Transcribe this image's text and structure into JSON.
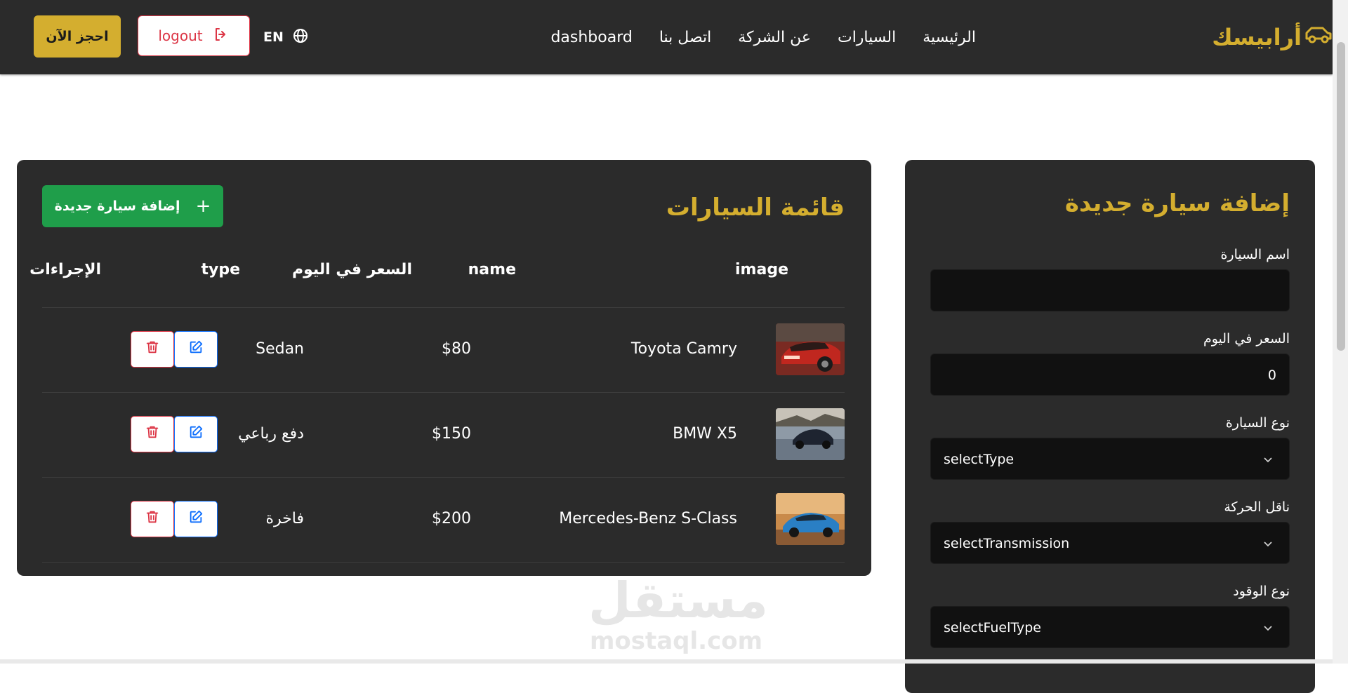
{
  "header": {
    "brand": "أرابيسك",
    "nav": [
      {
        "label": "الرئيسية"
      },
      {
        "label": "السيارات"
      },
      {
        "label": "عن الشركة"
      },
      {
        "label": "اتصل بنا"
      },
      {
        "label": "dashboard"
      }
    ],
    "language": "EN",
    "logout_label": "logout",
    "book_label": "احجز الآن"
  },
  "cars_list": {
    "title": "قائمة السيارات",
    "add_button_label": "إضافة سيارة جديدة",
    "columns": {
      "image": "image",
      "name": "name",
      "price": "السعر في اليوم",
      "type": "type",
      "actions": "الإجراءات"
    },
    "rows": [
      {
        "name": "Toyota Camry",
        "price": "$80",
        "type": "Sedan"
      },
      {
        "name": "BMW X5",
        "price": "$150",
        "type": "دفع رباعي"
      },
      {
        "name": "Mercedes-Benz S-Class",
        "price": "$200",
        "type": "فاخرة"
      }
    ]
  },
  "add_car_form": {
    "title": "إضافة سيارة جديدة",
    "fields": {
      "name": {
        "label": "اسم السيارة",
        "value": ""
      },
      "price": {
        "label": "السعر في اليوم",
        "value": "0"
      },
      "type": {
        "label": "نوع السيارة",
        "value": "selectType"
      },
      "transmission": {
        "label": "ناقل الحركة",
        "value": "selectTransmission"
      },
      "fuel": {
        "label": "نوع الوقود",
        "value": "selectFuelType"
      }
    }
  },
  "watermark": {
    "arabic": "مستقل",
    "latin": "mostaql.com"
  },
  "colors": {
    "accent": "#d4ae2f",
    "panel": "#2b2b2b",
    "field": "#111111",
    "success": "#1f9e4a",
    "danger": "#dc3545",
    "primary": "#0d6efd"
  },
  "icons": {
    "brand": "car-icon",
    "language": "globe-icon",
    "logout": "logout-icon",
    "add": "plus-icon",
    "edit": "edit-icon",
    "delete": "trash-icon",
    "select": "chevron-down-icon"
  }
}
